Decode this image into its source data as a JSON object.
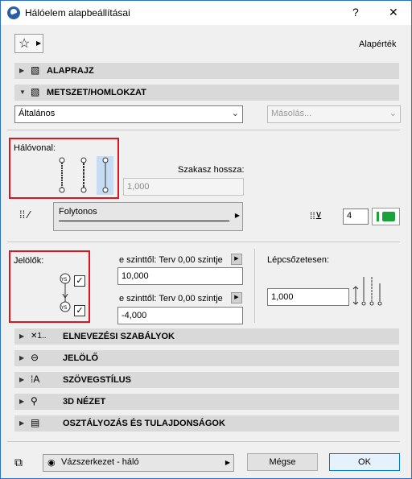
{
  "window": {
    "title": "Hálóelem alapbeállításai",
    "help": "?",
    "close": "✕"
  },
  "favorites": {
    "label": "Alapérték"
  },
  "panels": {
    "alaprajz": "ALAPRAJZ",
    "metszet": "METSZET/HOMLOKZAT",
    "elnevezesi": "ELNEVEZÉSI SZABÁLYOK",
    "jelolo": "JELÖLŐ",
    "szovegstilus": "SZÖVEGSTÍLUS",
    "nezet3d": "3D NÉZET",
    "osztalyozas": "OSZTÁLYOZÁS ÉS TULAJDONSÁGOK"
  },
  "view_select": {
    "value": "Általános"
  },
  "copy_select": {
    "placeholder": "Másolás..."
  },
  "halovonal": {
    "label": "Hálóvonal:"
  },
  "szakasz": {
    "label": "Szakasz hossza:",
    "value": "1,000"
  },
  "linetype": {
    "value": "Folytonos"
  },
  "pen": {
    "value": "4",
    "color": "#1aa33a"
  },
  "jelolok": {
    "label": "Jelölők:"
  },
  "from_level_1": {
    "label": "e szinttől: Terv 0,00 szintje",
    "value": "10,000"
  },
  "from_level_2": {
    "label": "e szinttől: Terv 0,00 szintje",
    "value": "-4,000"
  },
  "lepcsozetesen": {
    "label": "Lépcsőzetesen:",
    "value": "1,000"
  },
  "bottom": {
    "layer": "Vázszerkezet - háló",
    "cancel": "Mégse",
    "ok": "OK"
  }
}
